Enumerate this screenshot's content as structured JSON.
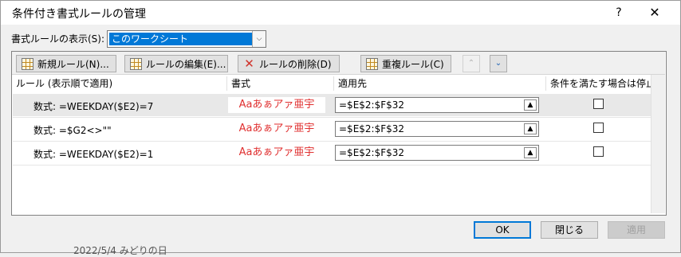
{
  "window": {
    "title": "条件付き書式ルールの管理",
    "help_label": "?",
    "close_label": "✕"
  },
  "show_rules": {
    "label": "書式ルールの表示(S):",
    "value": "このワークシート",
    "arrow": "⌵"
  },
  "toolbar": {
    "new_rule": "新規ルール(N)...",
    "edit_rule": "ルールの編集(E)...",
    "delete_rule": "ルールの削除(D)",
    "duplicate_rule": "重複ルール(C)",
    "move_up": "⌃",
    "move_down": "⌄"
  },
  "columns": {
    "rule": "ルール (表示順で適用)",
    "format": "書式",
    "applies_to": "適用先",
    "stop_if_true": "条件を満たす場合は停止"
  },
  "rules": [
    {
      "rule": "数式: =WEEKDAY($E2)=7",
      "preview": "Aaあぁアァ亜宇",
      "applies_to": "=$E$2:$F$32",
      "stop": false,
      "selected": true
    },
    {
      "rule": "数式: =$G2<>\"\"",
      "preview": "Aaあぁアァ亜宇",
      "applies_to": "=$E$2:$F$32",
      "stop": false,
      "selected": false
    },
    {
      "rule": "数式: =WEEKDAY($E2)=1",
      "preview": "Aaあぁアァ亜宇",
      "applies_to": "=$E$2:$F$32",
      "stop": false,
      "selected": false
    }
  ],
  "buttons": {
    "ok": "OK",
    "close": "閉じる",
    "apply": "適用"
  },
  "background": {
    "cell_text": "2022/5/4 みどりの日"
  },
  "colors": {
    "selection": "#0078d7",
    "preview_text": "#e03030",
    "selected_row": "#e8e8e8"
  }
}
